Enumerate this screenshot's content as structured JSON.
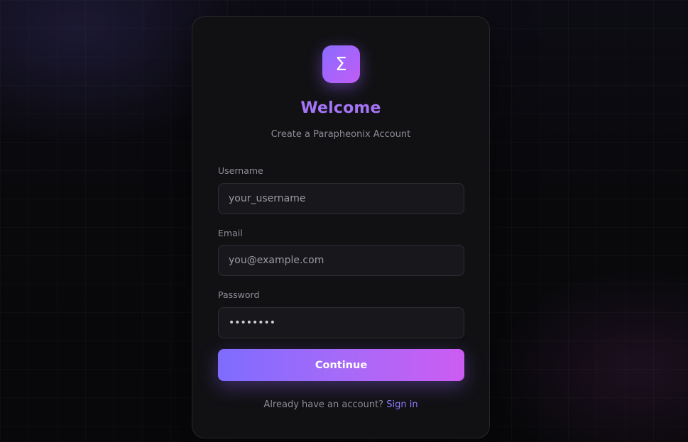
{
  "logo": {
    "icon": "sigma-icon",
    "glyph": "Σ",
    "colors": [
      "#8b6cff",
      "#c05cf5"
    ]
  },
  "header": {
    "title": "Welcome",
    "subtitle": "Create a Parapheonix Account"
  },
  "form": {
    "username": {
      "label": "Username",
      "placeholder": "your_username",
      "value": ""
    },
    "email": {
      "label": "Email",
      "placeholder": "you@example.com",
      "value": ""
    },
    "password": {
      "label": "Password",
      "placeholder": "",
      "value": "••••••••"
    },
    "submit_label": "Continue"
  },
  "footer": {
    "prompt": "Already have an account?",
    "link_label": "Sign in"
  },
  "colors": {
    "accent": "#a574f7",
    "link": "#8e7cff",
    "background": "#08080b",
    "card": "#111114"
  }
}
